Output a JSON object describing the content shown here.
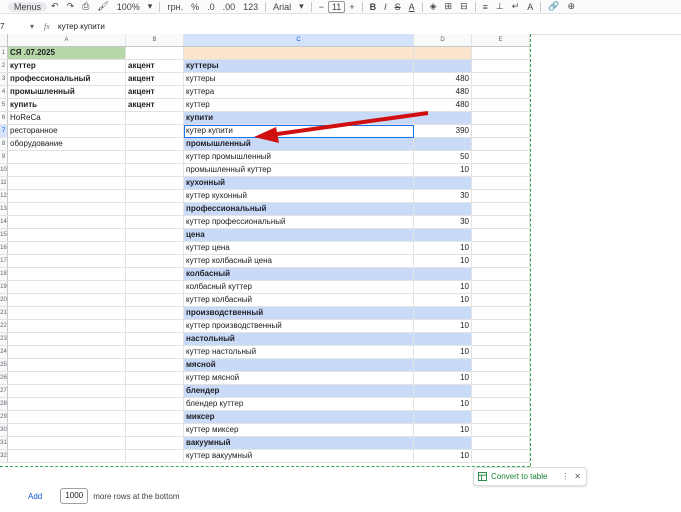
{
  "toolbar": {
    "menus": "Menus",
    "zoom": "100%",
    "currency": "грн.",
    "percent": "%",
    "dec_less": ".0",
    "dec_more": ".00",
    "format_123": "123",
    "font": "Arial",
    "font_size": "11",
    "minus": "−",
    "plus": "+",
    "bold": "B",
    "italic": "I",
    "strike": "S",
    "text_color": "A"
  },
  "formula_bar": {
    "cell_ref": "7",
    "fx": "fx",
    "value": "кутер купити"
  },
  "columns": [
    "A",
    "B",
    "C",
    "D",
    "E"
  ],
  "rows": [
    {
      "n": "1",
      "a": "СЯ .07.2025",
      "b": "",
      "c": "",
      "d": "",
      "a_style": "green",
      "c_style": "peach",
      "d_style": "peach"
    },
    {
      "n": "2",
      "a": "куттер",
      "b": "акцент",
      "c": "куттеры",
      "d": "",
      "a_bold": true,
      "b_bold": true,
      "c_style": "blue bold",
      "d_style": "blue"
    },
    {
      "n": "3",
      "a": "профессиональный",
      "b": "акцент",
      "c": "куттеры",
      "d": "480",
      "a_bold": true,
      "b_bold": true
    },
    {
      "n": "4",
      "a": "промышленный",
      "b": "акцент",
      "c": "куттера",
      "d": "480",
      "a_bold": true,
      "b_bold": true
    },
    {
      "n": "5",
      "a": "купить",
      "b": "акцент",
      "c": "куттер",
      "d": "480",
      "a_bold": true,
      "b_bold": true
    },
    {
      "n": "6",
      "a": "HoReCa",
      "b": "",
      "c": "купити",
      "d": "",
      "c_style": "blue bold",
      "d_style": "blue"
    },
    {
      "n": "7",
      "a": "ресторанное",
      "b": "",
      "c": "кутер купити",
      "d": "390",
      "selected": true
    },
    {
      "n": "8",
      "a": "оборудование",
      "b": "",
      "c": "промышленный",
      "d": "",
      "c_style": "blue bold",
      "d_style": "blue"
    },
    {
      "n": "9",
      "a": "",
      "b": "",
      "c": "куттер промышленный",
      "d": "50"
    },
    {
      "n": "10",
      "a": "",
      "b": "",
      "c": "промышленный куттер",
      "d": "10"
    },
    {
      "n": "11",
      "a": "",
      "b": "",
      "c": "кухонный",
      "d": "",
      "c_style": "blue bold",
      "d_style": "blue"
    },
    {
      "n": "12",
      "a": "",
      "b": "",
      "c": "куттер кухонный",
      "d": "30"
    },
    {
      "n": "13",
      "a": "",
      "b": "",
      "c": "профессиональный",
      "d": "",
      "c_style": "blue bold",
      "d_style": "blue"
    },
    {
      "n": "14",
      "a": "",
      "b": "",
      "c": "куттер профессиональный",
      "d": "30"
    },
    {
      "n": "15",
      "a": "",
      "b": "",
      "c": "цена",
      "d": "",
      "c_style": "blue bold",
      "d_style": "blue"
    },
    {
      "n": "16",
      "a": "",
      "b": "",
      "c": "куттер цена",
      "d": "10"
    },
    {
      "n": "17",
      "a": "",
      "b": "",
      "c": "куттер колбасный цена",
      "d": "10"
    },
    {
      "n": "18",
      "a": "",
      "b": "",
      "c": "колбасный",
      "d": "",
      "c_style": "blue bold",
      "d_style": "blue"
    },
    {
      "n": "19",
      "a": "",
      "b": "",
      "c": "колбасный куттер",
      "d": "10"
    },
    {
      "n": "20",
      "a": "",
      "b": "",
      "c": "куттер колбасный",
      "d": "10"
    },
    {
      "n": "21",
      "a": "",
      "b": "",
      "c": "производственный",
      "d": "",
      "c_style": "blue bold",
      "d_style": "blue"
    },
    {
      "n": "22",
      "a": "",
      "b": "",
      "c": "куттер производственный",
      "d": "10"
    },
    {
      "n": "23",
      "a": "",
      "b": "",
      "c": "настольный",
      "d": "",
      "c_style": "blue bold",
      "d_style": "blue"
    },
    {
      "n": "24",
      "a": "",
      "b": "",
      "c": "куттер настольный",
      "d": "10"
    },
    {
      "n": "25",
      "a": "",
      "b": "",
      "c": "мясной",
      "d": "",
      "c_style": "blue bold",
      "d_style": "blue"
    },
    {
      "n": "26",
      "a": "",
      "b": "",
      "c": "куттер мясной",
      "d": "10"
    },
    {
      "n": "27",
      "a": "",
      "b": "",
      "c": "блендер",
      "d": "",
      "c_style": "blue bold",
      "d_style": "blue"
    },
    {
      "n": "28",
      "a": "",
      "b": "",
      "c": "блендер куттер",
      "d": "10"
    },
    {
      "n": "29",
      "a": "",
      "b": "",
      "c": "миксер",
      "d": "",
      "c_style": "blue bold",
      "d_style": "blue"
    },
    {
      "n": "30",
      "a": "",
      "b": "",
      "c": "куттер миксер",
      "d": "10"
    },
    {
      "n": "31",
      "a": "",
      "b": "",
      "c": "вакуумный",
      "d": "",
      "c_style": "blue bold",
      "d_style": "blue"
    },
    {
      "n": "32",
      "a": "",
      "b": "",
      "c": "куттер вакуумный",
      "d": "10"
    }
  ],
  "bottom": {
    "add_label": "Add",
    "rows_value": "1000",
    "more_rows_text": "more rows at the bottom"
  },
  "convert_popup": {
    "label": "Convert to table",
    "menu_glyph": "⋮",
    "close_glyph": "✕"
  },
  "colors": {
    "header_green": "#b6d7a8",
    "header_peach": "#fce5cd",
    "group_blue": "#c9daf8",
    "arrow_red": "#d01010",
    "selection_blue": "#1a73e8"
  }
}
